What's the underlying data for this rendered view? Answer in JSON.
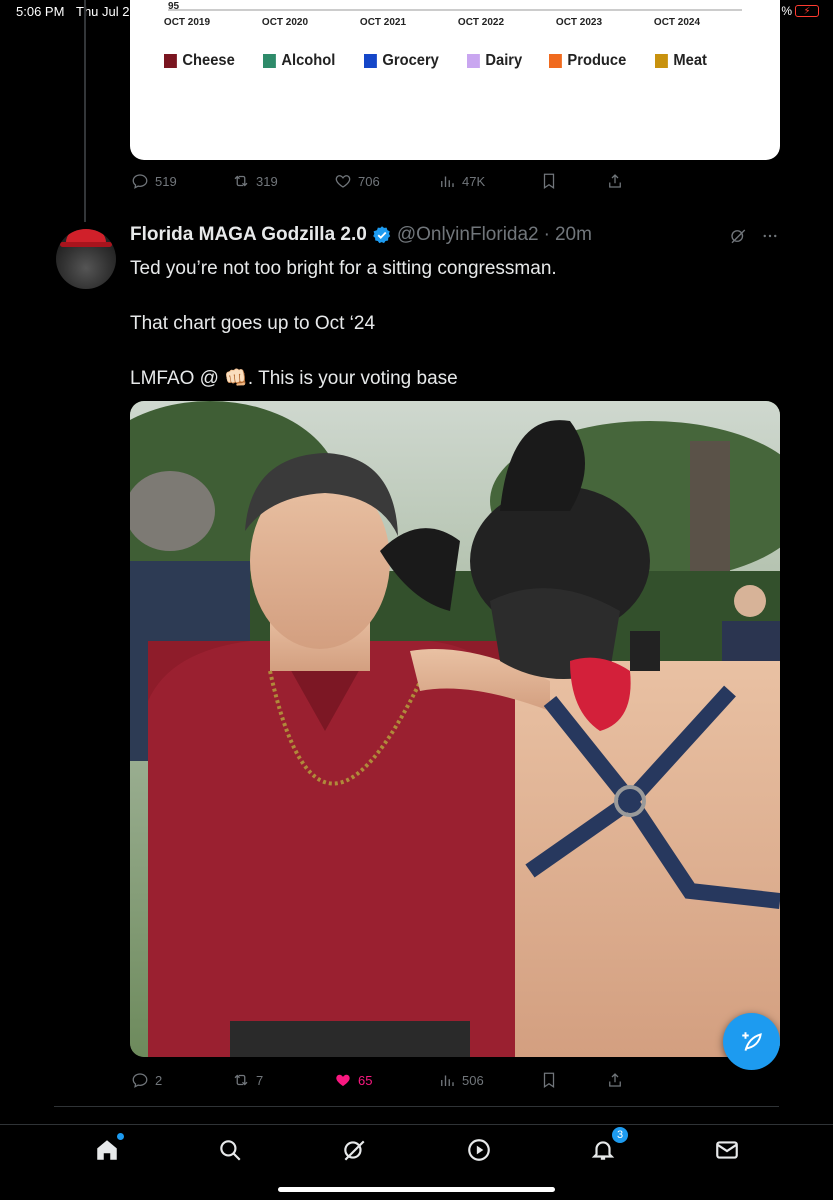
{
  "status_bar": {
    "time": "5:06 PM",
    "date": "Thu Jul 2",
    "battery_text": "%"
  },
  "chart_card": {
    "y_tick_top": "95",
    "x_ticks": [
      "OCT 2019",
      "OCT 2020",
      "OCT 2021",
      "OCT 2022",
      "OCT 2023",
      "OCT 2024"
    ],
    "legend": [
      {
        "label": "Cheese",
        "color": "#7a1520"
      },
      {
        "label": "Alcohol",
        "color": "#2e8b6a"
      },
      {
        "label": "Grocery",
        "color": "#1446c8"
      },
      {
        "label": "Dairy",
        "color": "#c9a6f0"
      },
      {
        "label": "Produce",
        "color": "#f06a1e"
      },
      {
        "label": "Meat",
        "color": "#c8920e"
      }
    ]
  },
  "prev_tweet_actions": {
    "replies": "519",
    "reposts": "319",
    "likes": "706",
    "views": "47K"
  },
  "tweet": {
    "display_name": "Florida MAGA Godzilla 2.0",
    "handle": "@OnlyinFlorida2",
    "separator": "·",
    "time": "20m",
    "lines": [
      "Ted you’re not too bright for a sitting congressman.",
      "That chart goes up to Oct ‘24",
      "LMFAO @ 👊🏻. This is your voting base"
    ],
    "actions": {
      "replies": "2",
      "reposts": "7",
      "likes": "65",
      "views": "506"
    }
  },
  "colors": {
    "accent": "#1d9bf0",
    "like_active": "#f91880",
    "muted": "#71767b"
  },
  "bottom_nav": {
    "items": [
      "home-icon",
      "search-icon",
      "grok-icon",
      "spaces-icon",
      "notifications-icon",
      "messages-icon"
    ],
    "notifications_badge": "3"
  }
}
